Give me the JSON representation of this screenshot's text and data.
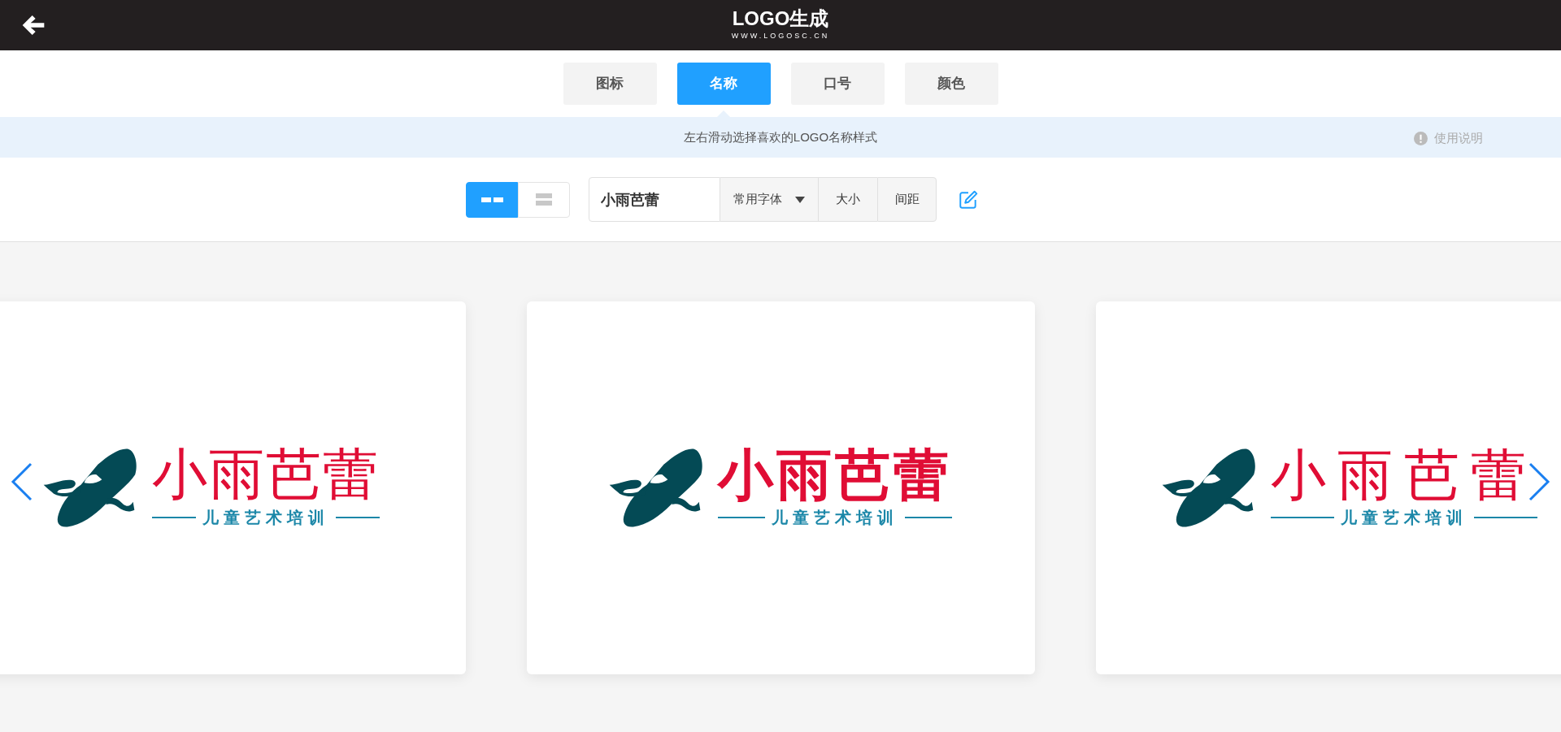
{
  "header": {
    "logo": "LOGO生成",
    "logo_url": "WWW.LOGOSC.CN"
  },
  "tabs": [
    {
      "label": "图标",
      "selected": false
    },
    {
      "label": "名称",
      "selected": true
    },
    {
      "label": "口号",
      "selected": false
    },
    {
      "label": "颜色",
      "selected": false
    }
  ],
  "hint_bar": {
    "text": "左右滑动选择喜欢的LOGO名称样式",
    "help": "使用说明"
  },
  "toolbar": {
    "layouts": [
      {
        "kind": "horizontal",
        "selected": true
      },
      {
        "kind": "vertical",
        "selected": false
      }
    ],
    "name_field": {
      "value": "小雨芭蕾"
    },
    "font_select": {
      "value": "常用字体"
    },
    "buttons": [
      "大小",
      "间距"
    ]
  },
  "cards": [
    {
      "kind": "serif",
      "name": "小雨芭蕾",
      "slogan": "儿童艺术培训"
    },
    {
      "kind": "bold",
      "name": "小雨芭蕾",
      "slogan": "儿童艺术培训"
    },
    {
      "kind": "thin",
      "name": "小雨芭蕾",
      "slogan": "儿童艺术培训"
    }
  ]
}
